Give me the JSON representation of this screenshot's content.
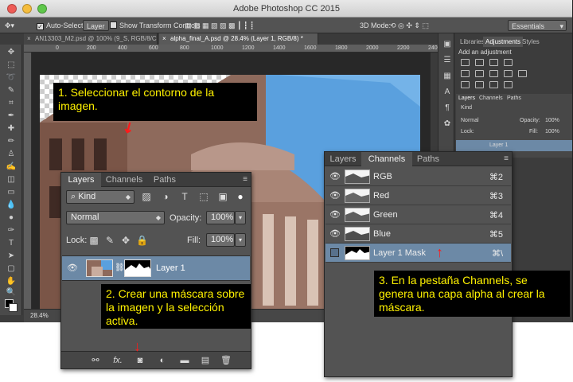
{
  "app_title": "Adobe Photoshop CC 2015",
  "options_bar": {
    "auto_select_label": "Auto-Select:",
    "auto_select_value": "Layer",
    "transform_label": "Show Transform Controls",
    "mode_3d_label": "3D Mode:",
    "workspace_value": "Essentials"
  },
  "doc_tabs": [
    {
      "label": "AN13303_M2.psd @ 100% (9_S, RGB/8/CMYK)"
    },
    {
      "label": "alpha_final_A.psd @ 28.4% (Layer 1, RGB/8) *"
    }
  ],
  "ruler_ticks": [
    "0",
    "200",
    "400",
    "600",
    "800",
    "1000",
    "1200",
    "1400",
    "1600",
    "1800",
    "2000",
    "2200",
    "2400"
  ],
  "status": {
    "zoom": "28.4%"
  },
  "right_dock": {
    "top_tabs": [
      "Libraries",
      "Adjustments",
      "Styles"
    ],
    "adjustments_title": "Add an adjustment",
    "mini_tabs": [
      "Layers",
      "Channels",
      "Paths"
    ],
    "mini_kind": "Kind",
    "mini_mode": "Normal",
    "mini_opacity_label": "Opacity:",
    "mini_opacity": "100%",
    "mini_lock": "Lock:",
    "mini_fill_label": "Fill:",
    "mini_fill": "100%",
    "mini_layer": "Layer 1"
  },
  "layers_panel": {
    "tabs": [
      "Layers",
      "Channels",
      "Paths"
    ],
    "kind_label": "Kind",
    "blend_mode": "Normal",
    "opacity_label": "Opacity:",
    "opacity_value": "100%",
    "lock_label": "Lock:",
    "fill_label": "Fill:",
    "fill_value": "100%",
    "layer_name": "Layer 1",
    "footer_fx": "fx."
  },
  "channels_panel": {
    "tabs": [
      "Layers",
      "Channels",
      "Paths"
    ],
    "rows": [
      {
        "name": "RGB",
        "shortcut": "⌘2"
      },
      {
        "name": "Red",
        "shortcut": "⌘3"
      },
      {
        "name": "Green",
        "shortcut": "⌘4"
      },
      {
        "name": "Blue",
        "shortcut": "⌘5"
      },
      {
        "name": "Layer 1 Mask",
        "shortcut": "⌘\\"
      }
    ]
  },
  "callouts": {
    "step1": "1. Seleccionar el contorno de la imagen.",
    "step2": "2. Crear una máscara sobre la imagen y la selección activa.",
    "step3": "3. En la pestaña Channels, se genera una capa alpha al crear la máscara."
  },
  "colors": {
    "callout_text": "#fff200",
    "callout_bg": "#000000",
    "arrow": "#ff1a1a",
    "selection": "#6c89a6",
    "panel_bg": "#535353"
  }
}
